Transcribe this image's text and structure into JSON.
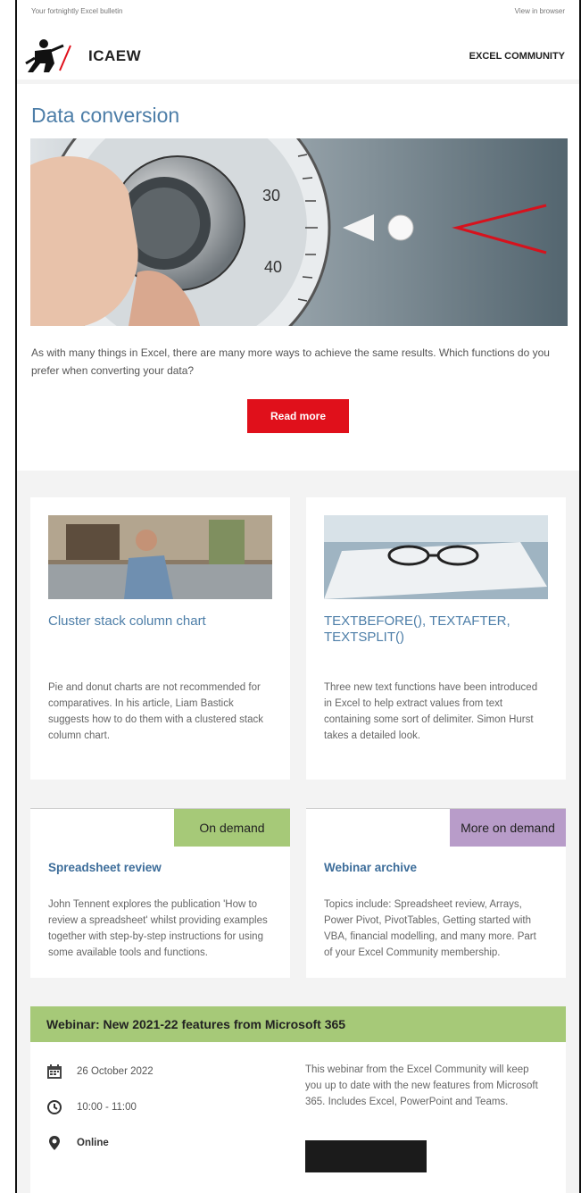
{
  "topbar": {
    "bulletin": "Your fortnightly Excel bulletin",
    "view_browser": "View in browser"
  },
  "header": {
    "logo_text": "ICAEW",
    "community": "EXCEL COMMUNITY"
  },
  "hero": {
    "title": "Data conversion",
    "text": "As with many things in Excel, there are many more ways to achieve the same results. Which functions do you prefer when converting your data?",
    "button": "Read more"
  },
  "articles": [
    {
      "title": "Cluster stack column chart",
      "text": "Pie and donut charts are not recommended for comparatives. In his article, Liam Bastick suggests how to do them with a clustered stack column chart."
    },
    {
      "title": "TEXTBEFORE(), TEXTAFTER, TEXTSPLIT()",
      "text": "Three new text functions have been introduced in Excel to help extract values from text containing some sort of delimiter. Simon Hurst takes a detailed look."
    }
  ],
  "on_demand": [
    {
      "tag": "On demand",
      "title": "Spreadsheet review",
      "text": "John Tennent explores the publication 'How to review a spreadsheet' whilst providing examples together with step-by-step instructions for using some available tools and functions."
    },
    {
      "tag": "More on demand",
      "title": "Webinar archive",
      "text": "Topics include: Spreadsheet review, Arrays, Power Pivot, PivotTables, Getting started with VBA, financial modelling, and many more. Part of your Excel Community membership."
    }
  ],
  "webinar": {
    "title": "Webinar: New 2021-22 features from Microsoft 365",
    "date": "26 October 2022",
    "time": "10:00 - 11:00",
    "location": "Online",
    "description": "This webinar from the Excel Community will keep you up to date with the new features from Microsoft 365. Includes Excel, PowerPoint and Teams."
  },
  "colors": {
    "accent_blue": "#4d7ea8",
    "button_red": "#e0101b",
    "tag_green": "#a6c978",
    "tag_purple": "#b89cc9"
  },
  "icons": [
    "calendar-icon",
    "clock-icon",
    "location-pin-icon"
  ]
}
